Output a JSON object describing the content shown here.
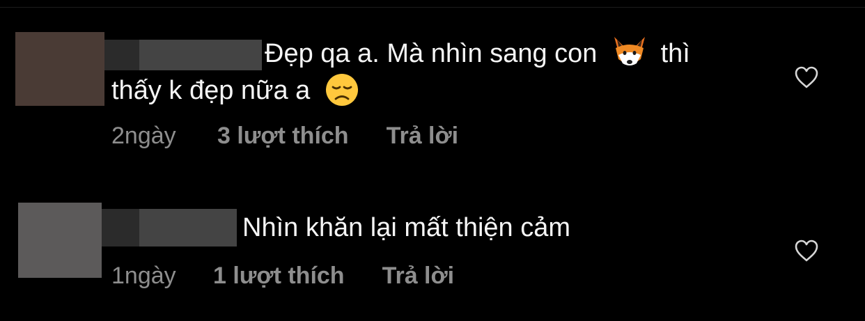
{
  "colors": {
    "background": "#000000",
    "text": "#f5f5f5",
    "meta_text": "#8e8e8e"
  },
  "comments": [
    {
      "avatar_color": "#4a3b35",
      "text_line1": "Đẹp qa a. Mà nhìn sang con",
      "emoji1": "fox-face-emoji",
      "text_line1_end": "thì",
      "text_line2": "thấy k đẹp nữa a",
      "emoji2": "disappointed-face-emoji",
      "time": "2ngày",
      "likes": "3 lượt thích",
      "reply": "Trả lời",
      "like_icon": "heart-outline-icon"
    },
    {
      "avatar_color": "#5c5a5a",
      "text_line1": "Nhìn khăn lại mất thiện cảm",
      "time": "1ngày",
      "likes": "1 lượt thích",
      "reply": "Trả lời",
      "like_icon": "heart-outline-icon"
    }
  ]
}
